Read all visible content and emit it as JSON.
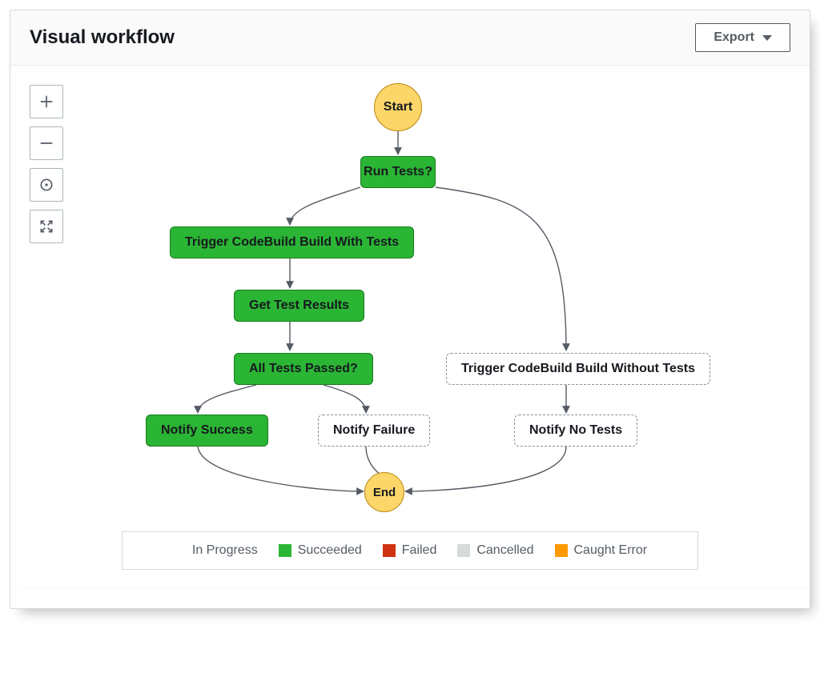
{
  "header": {
    "title": "Visual workflow",
    "export_label": "Export"
  },
  "tools": {
    "zoom_in": "Zoom in",
    "zoom_out": "Zoom out",
    "center": "Center graph",
    "expand": "Expand"
  },
  "nodes": {
    "start": "Start",
    "run_tests": "Run Tests?",
    "trigger_with_tests": "Trigger CodeBuild Build With Tests",
    "get_test_results": "Get Test Results",
    "all_tests_passed": "All Tests Passed?",
    "notify_success": "Notify Success",
    "notify_failure": "Notify Failure",
    "trigger_without_tests": "Trigger CodeBuild Build Without Tests",
    "notify_no_tests": "Notify No Tests",
    "end": "End"
  },
  "node_states": {
    "start": "start",
    "run_tests": "succeeded",
    "trigger_with_tests": "succeeded",
    "get_test_results": "succeeded",
    "all_tests_passed": "succeeded",
    "notify_success": "succeeded",
    "notify_failure": "not_run",
    "trigger_without_tests": "not_run",
    "notify_no_tests": "not_run",
    "end": "end"
  },
  "legend": {
    "in_progress": {
      "label": "In Progress",
      "color": "#2ea7cc"
    },
    "succeeded": {
      "label": "Succeeded",
      "color": "#2bb534"
    },
    "failed": {
      "label": "Failed",
      "color": "#d13212"
    },
    "cancelled": {
      "label": "Cancelled",
      "color": "#d5dbdb"
    },
    "caught": {
      "label": "Caught Error",
      "color": "#ff9900"
    }
  }
}
